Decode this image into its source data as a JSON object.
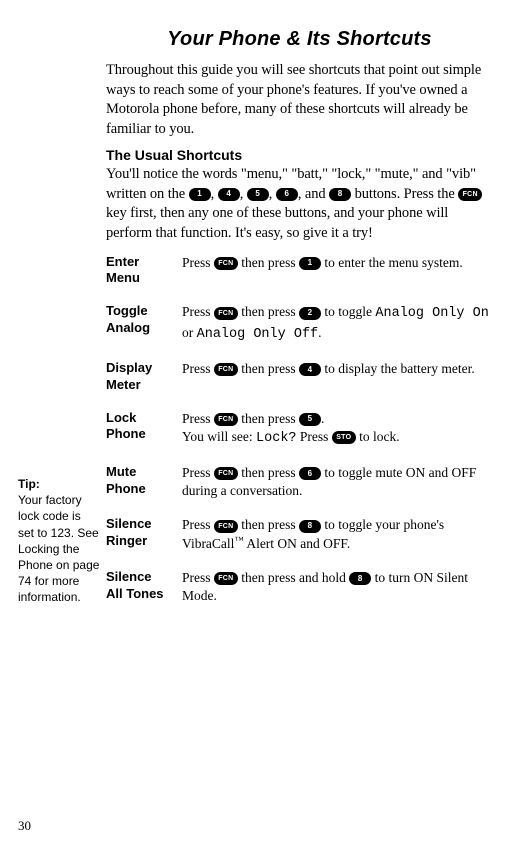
{
  "page_number": "30",
  "title": "Your Phone & Its Shortcuts",
  "intro": "Throughout this guide you will see shortcuts that point out simple ways to reach some of your phone's features. If you've owned a Motorola phone before, many of these shortcuts will already be familiar to you.",
  "usual_heading": "The Usual Shortcuts",
  "usual_p1_a": "You'll notice the words \"menu,\" \"batt,\" \"lock,\" \"mute,\" and \"vib\" written on the ",
  "usual_p1_b": ", ",
  "usual_p1_c": ", ",
  "usual_p1_d": ", ",
  "usual_p1_e": ", and ",
  "usual_p1_f": " buttons. Press the ",
  "usual_p1_g": " key first, then any one of these buttons, and your phone will perform that function. It's easy, so give it a try!",
  "key_1": "1",
  "key_2": "2",
  "key_4": "4",
  "key_5": "5",
  "key_6": "6",
  "key_8": "8",
  "key_fcn": "FCN",
  "key_sto": "STO",
  "tip_head": "Tip:",
  "tip_body": "Your factory lock code is set to 123. See Locking the Phone on page 74 for more information.",
  "shortcuts": [
    {
      "label_a": "Enter",
      "label_b": "Menu",
      "d1": "Press ",
      "d2": " then press ",
      "d3": " to enter the menu system.",
      "k1": "FCN",
      "k2": "1"
    },
    {
      "label_a": "Toggle",
      "label_b": "Analog",
      "d1": "Press ",
      "d2": " then press ",
      "d3": " to toggle ",
      "d4": " or ",
      "d5": ".",
      "lcd1": "Analog Only On",
      "lcd2": "Analog Only Off",
      "k1": "FCN",
      "k2": "2"
    },
    {
      "label_a": "Display",
      "label_b": "Meter",
      "d1": "Press ",
      "d2": " then press ",
      "d3": " to display the battery meter.",
      "k1": "FCN",
      "k2": "4"
    },
    {
      "label_a": "Lock",
      "label_b": "Phone",
      "d1": "Press ",
      "d2": " then press ",
      "d3": ".",
      "d4": "You will see: ",
      "lcd1": "Lock?",
      "d5": " Press ",
      "d6": " to lock.",
      "k1": "FCN",
      "k2": "5",
      "k3": "STO"
    },
    {
      "label_a": "Mute",
      "label_b": "Phone",
      "d1": "Press ",
      "d2": " then press ",
      "d3": " to toggle mute ON and OFF during a conversation.",
      "k1": "FCN",
      "k2": "6"
    },
    {
      "label_a": "Silence",
      "label_b": "Ringer",
      "d1": "Press ",
      "d2": " then press ",
      "d3": " to toggle your phone's VibraCall",
      "d4": " Alert ON and OFF.",
      "tm": "™",
      "k1": "FCN",
      "k2": "8"
    },
    {
      "label_a": "Silence",
      "label_b": "All Tones",
      "d1": "Press ",
      "d2": " then press and hold ",
      "d3": " to turn ON Silent Mode.",
      "k1": "FCN",
      "k2": "8"
    }
  ]
}
